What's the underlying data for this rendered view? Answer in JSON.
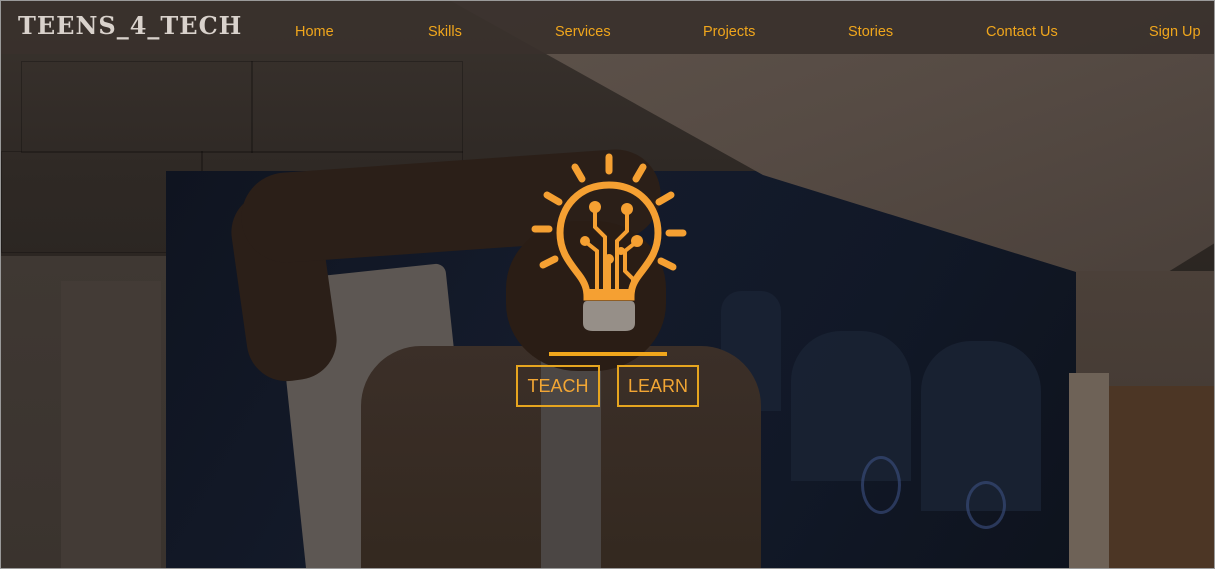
{
  "site": {
    "logo": "TEENS_4_TECH"
  },
  "nav": {
    "items": [
      {
        "label": "Home"
      },
      {
        "label": "Skills"
      },
      {
        "label": "Services"
      },
      {
        "label": "Projects"
      },
      {
        "label": "Stories"
      },
      {
        "label": "Contact Us"
      },
      {
        "label": "Sign Up"
      }
    ]
  },
  "hero": {
    "icon": "lightbulb-circuit-icon",
    "buttons": {
      "teach": "TEACH",
      "learn": "LEARN"
    }
  },
  "colors": {
    "accent": "#f0a61c",
    "nav_background": "#3a312d",
    "logo_text": "#d9d2cc"
  }
}
